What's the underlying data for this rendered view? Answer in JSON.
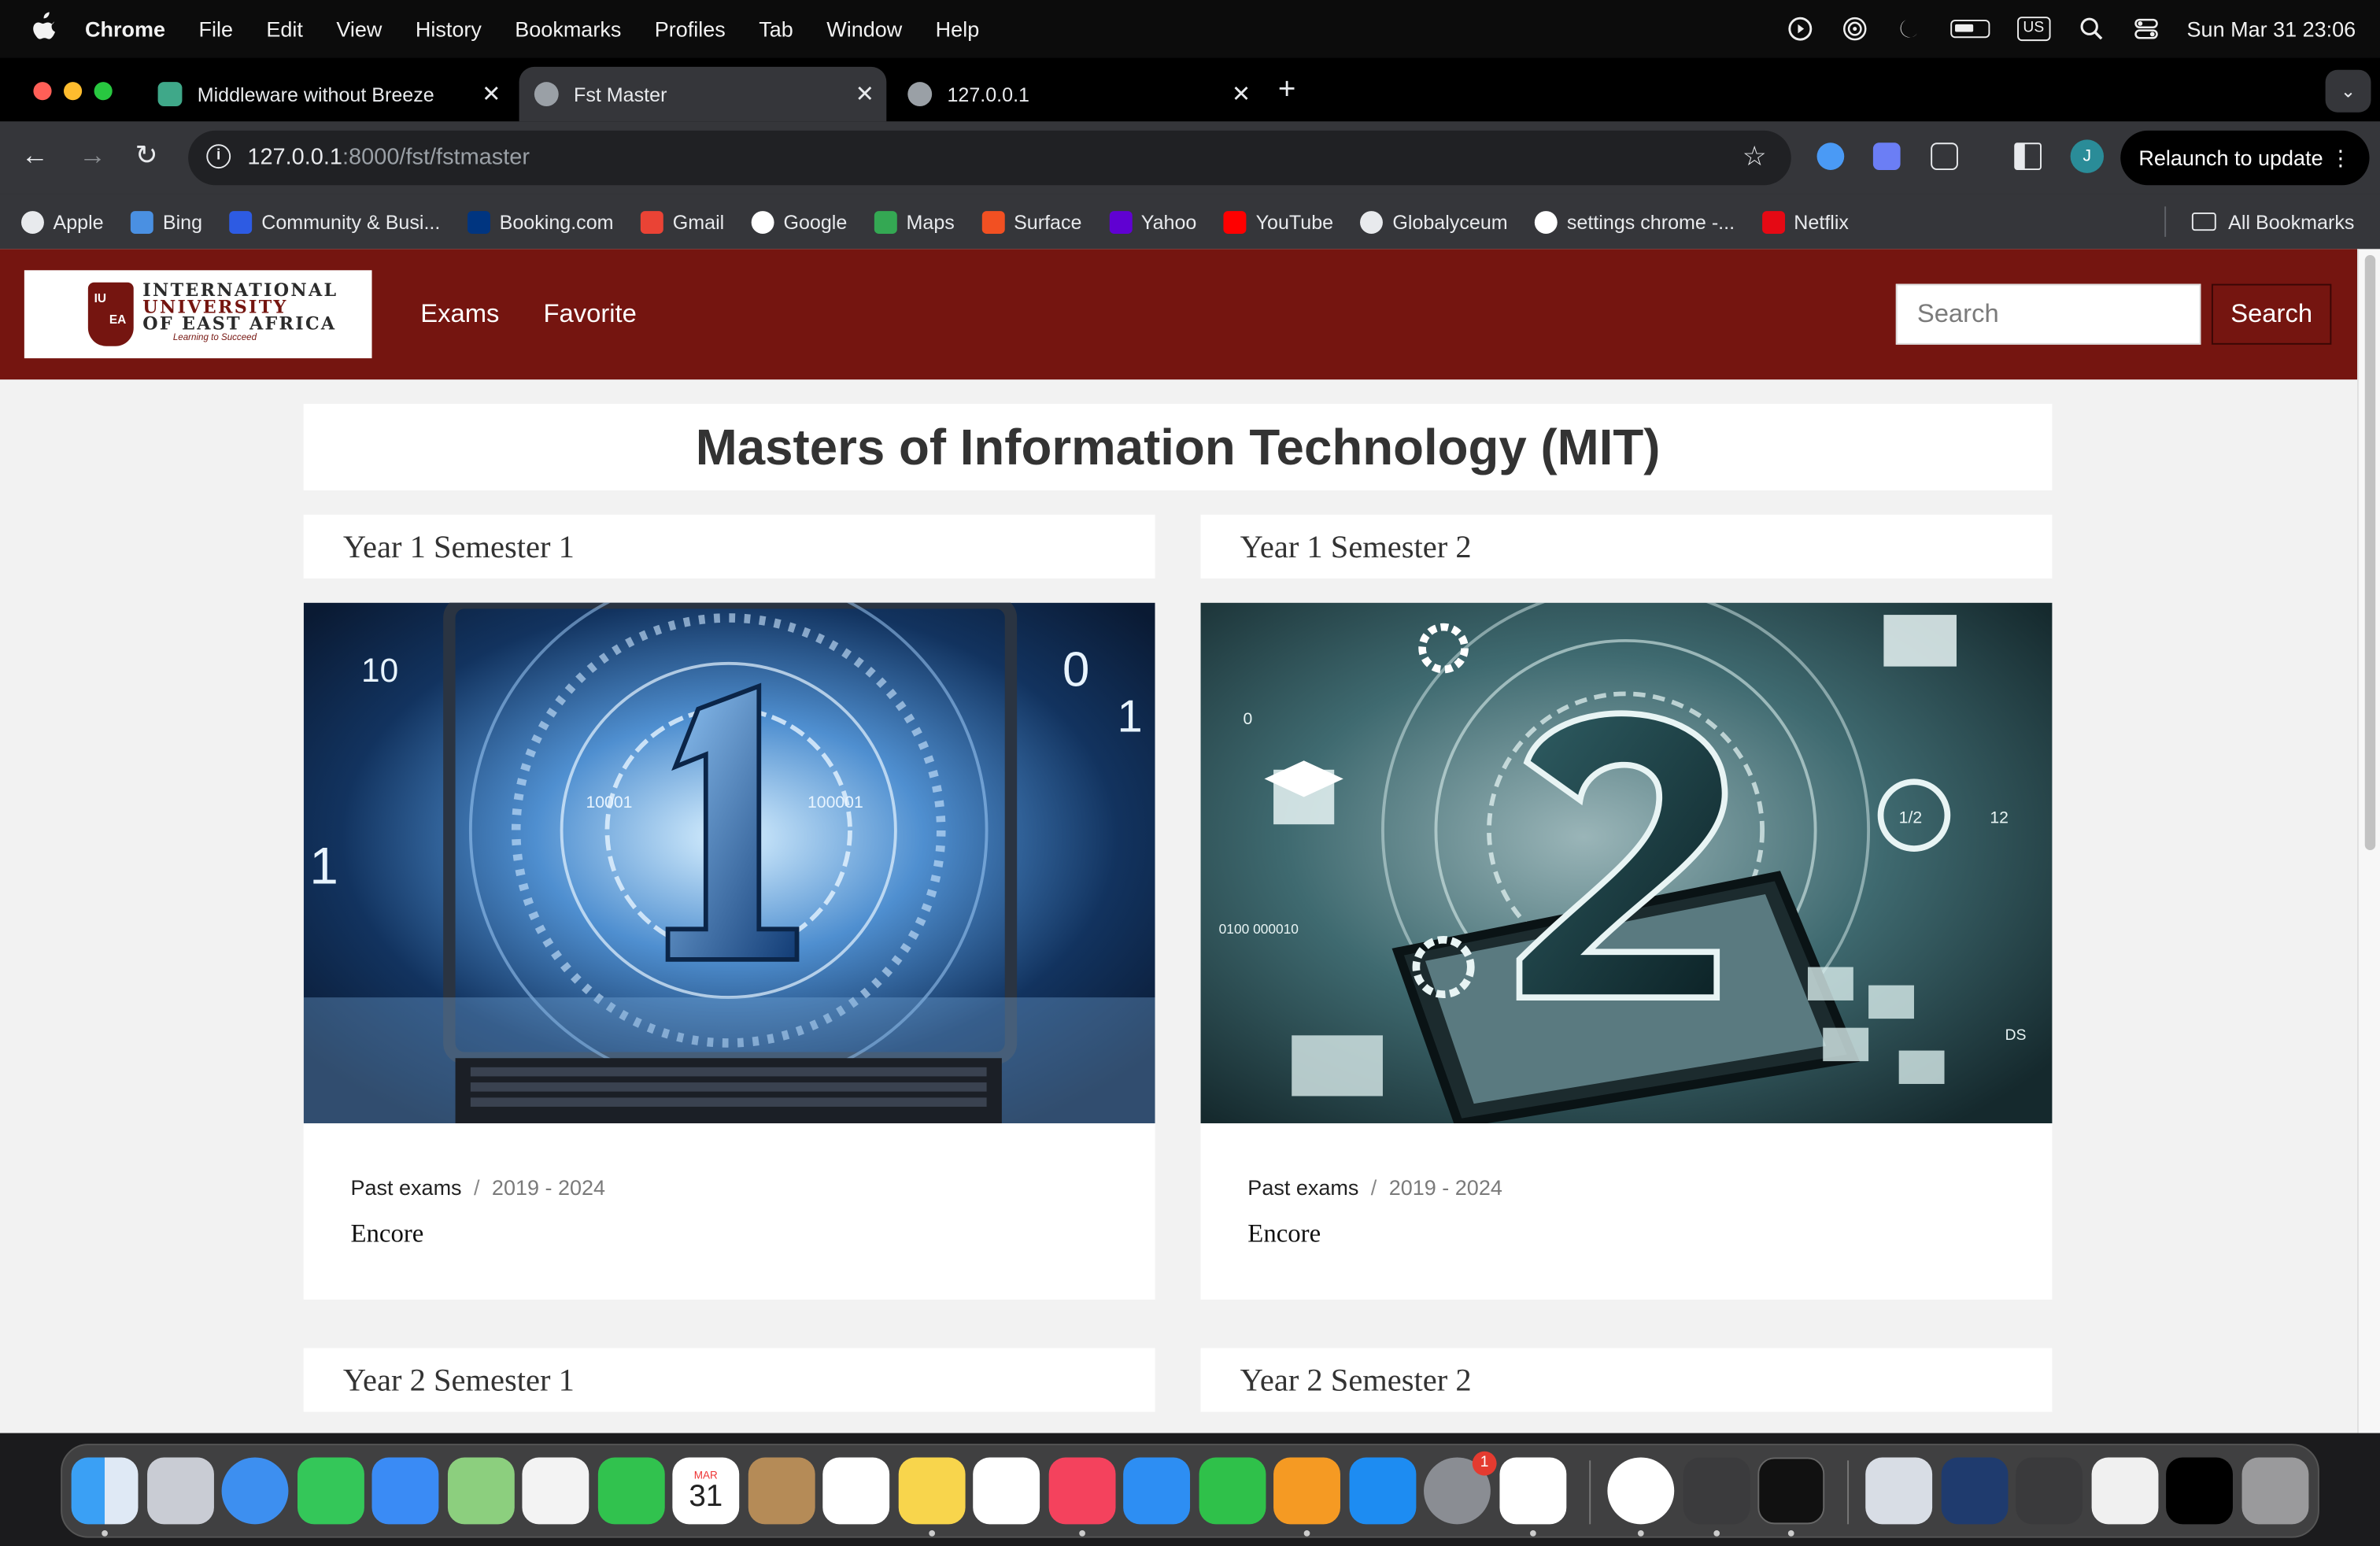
{
  "menubar": {
    "app": "Chrome",
    "items": [
      "File",
      "Edit",
      "View",
      "History",
      "Bookmarks",
      "Profiles",
      "Tab",
      "Window",
      "Help"
    ],
    "keyboard": "US",
    "datetime": "Sun Mar 31  23:06"
  },
  "tabs": [
    {
      "title": "Middleware without Breeze",
      "active": false
    },
    {
      "title": "Fst Master",
      "active": true
    },
    {
      "title": "127.0.0.1",
      "active": false
    }
  ],
  "address": {
    "host": "127.0.0.1",
    "path": ":8000/fst/fstmaster"
  },
  "relaunch_label": "Relaunch to update",
  "profile_initial": "J",
  "bookmarks": [
    {
      "label": "Apple",
      "color": "#e8eaed"
    },
    {
      "label": "Bing",
      "color": "#4a90e2"
    },
    {
      "label": "Community & Busi...",
      "color": "#2d5be3"
    },
    {
      "label": "Booking.com",
      "color": "#003580"
    },
    {
      "label": "Gmail",
      "color": "#ea4335"
    },
    {
      "label": "Google",
      "color": "#ffffff"
    },
    {
      "label": "Maps",
      "color": "#34a853"
    },
    {
      "label": "Surface",
      "color": "#f25022"
    },
    {
      "label": "Yahoo",
      "color": "#6001d2"
    },
    {
      "label": "YouTube",
      "color": "#ff0000"
    },
    {
      "label": "Globalyceum",
      "color": "#e8eaed"
    },
    {
      "label": "settings chrome -...",
      "color": "#ffffff"
    },
    {
      "label": "Netflix",
      "color": "#e50914"
    }
  ],
  "all_bookmarks": "All Bookmarks",
  "site": {
    "logo": {
      "line1": "INTERNATIONAL",
      "line2": "UNIVERSITY",
      "line3": "OF EAST AFRICA",
      "tagline": "Learning to Succeed",
      "crest_top": "IU",
      "crest_bottom": "EA"
    },
    "nav": [
      "Exams",
      "Favorite"
    ],
    "search_placeholder": "Search",
    "search_button": "Search",
    "page_title": "Masters of Information Technology (MIT)",
    "cards": [
      {
        "heading": "Year 1 Semester 1",
        "numeral": "1",
        "crumb": "Past exams",
        "years": "2019 - 2024",
        "label": "Encore"
      },
      {
        "heading": "Year 1 Semester 2",
        "numeral": "2",
        "crumb": "Past exams",
        "years": "2019 - 2024",
        "label": "Encore"
      },
      {
        "heading": "Year 2 Semester 1"
      },
      {
        "heading": "Year 2 Semester 2"
      }
    ]
  },
  "dock": {
    "apps": [
      "Finder",
      "Launchpad",
      "Safari",
      "Messages",
      "Mail",
      "Maps",
      "Photos",
      "FaceTime",
      "Calendar",
      "Contacts",
      "Reminders",
      "Notes",
      "Freeform",
      "Music",
      "Keynote",
      "Numbers",
      "Pages",
      "App Store",
      "System Settings",
      "VS Code",
      "Chrome",
      "Unity",
      "Terminal"
    ],
    "calendar_month": "MAR",
    "calendar_day": "31",
    "settings_badge": "1"
  },
  "colors": {
    "brand": "#751510",
    "page_bg": "#f2f2f2"
  }
}
